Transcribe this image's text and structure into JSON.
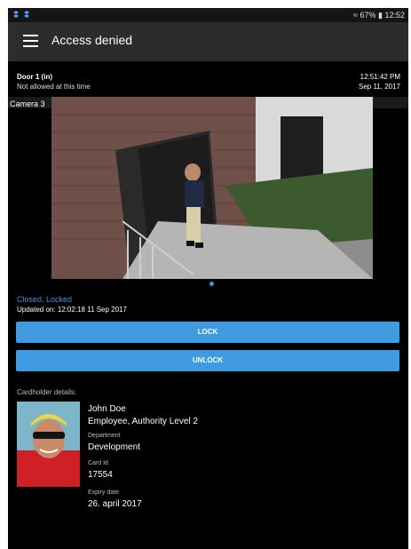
{
  "status_bar": {
    "battery": "67%",
    "clock": "12:52"
  },
  "app_bar": {
    "title": "Access denied"
  },
  "event": {
    "door": "Door 1 (in)",
    "reason": "Not allowed at this time",
    "time": "12:51:42 PM",
    "date": "Sep 11, 2017"
  },
  "camera": {
    "label": "Camera 3"
  },
  "door_state": {
    "status": "Closed, Locked",
    "updated": "Updated on: 12:02:18 11 Sep 2017"
  },
  "actions": {
    "lock_label": "LOCK",
    "unlock_label": "UNLOCK"
  },
  "cardholder": {
    "header": "Cardholder details:",
    "name": "John Doe",
    "role": "Employee, Authority Level 2",
    "department_label": "Department",
    "department": "Development",
    "card_id_label": "Card Id",
    "card_id": "17554",
    "expiry_label": "Expiry date",
    "expiry": "26. april 2017"
  },
  "colors": {
    "accent": "#2f9ae6",
    "button": "#3f9ae0",
    "appbar": "#2c2c2c",
    "background": "#000000"
  }
}
